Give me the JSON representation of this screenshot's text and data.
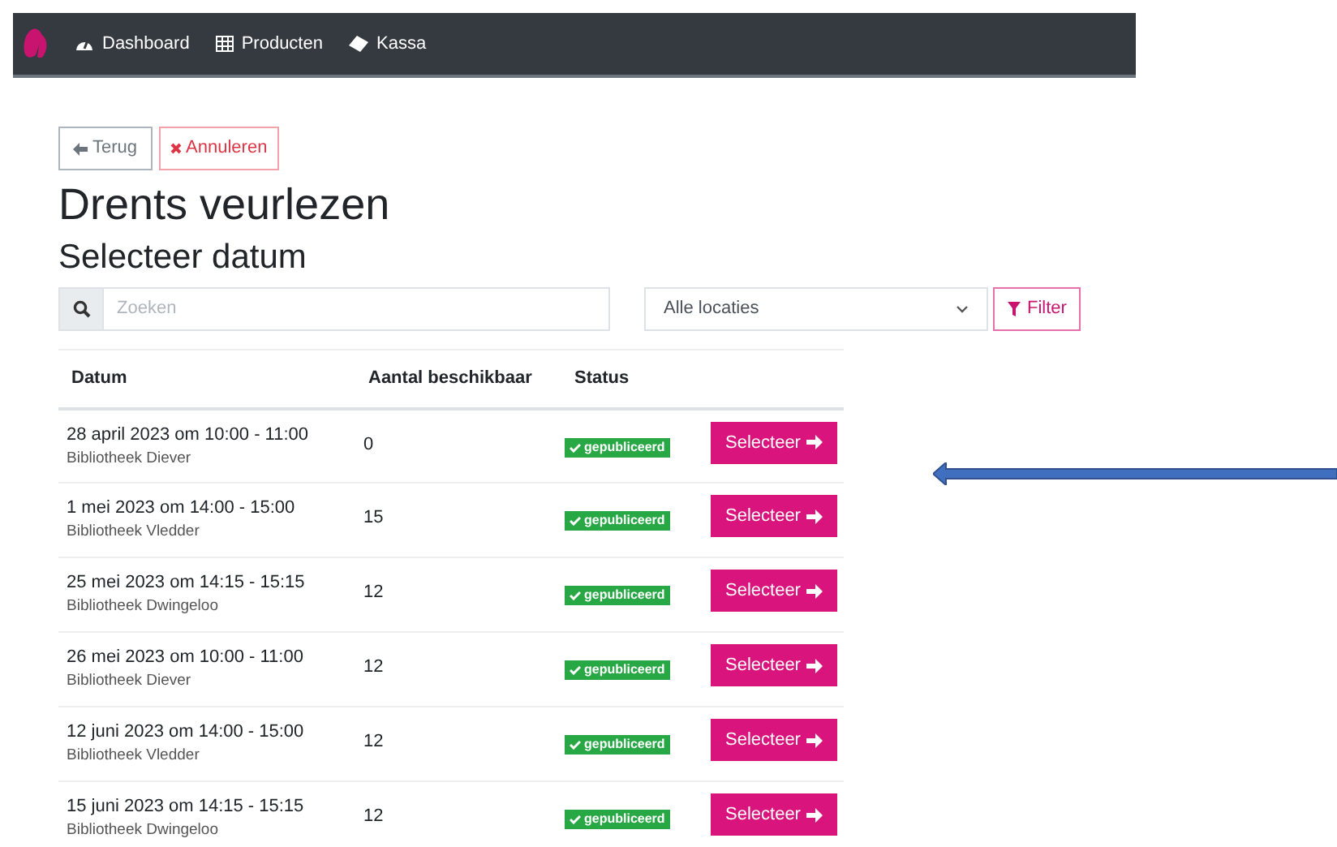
{
  "navbar": {
    "items": [
      {
        "label": "Dashboard"
      },
      {
        "label": "Producten"
      },
      {
        "label": "Kassa"
      }
    ]
  },
  "buttons": [
    {
      "label": "Terug",
      "kind": "back"
    },
    {
      "label": "Annuleren",
      "kind": "cancel"
    }
  ],
  "title": "Drents veurlezen",
  "subtitle": "Selecteer datum",
  "search": {
    "placeholder": "Zoeken"
  },
  "location_select": {
    "value": "Alle locaties"
  },
  "filter_button": "Filter",
  "table": {
    "columns": [
      "Datum",
      "Aantal beschikbaar",
      "Status"
    ],
    "rows": [
      {
        "date": "28 april 2023 om 10:00 - 11:00",
        "location": "Bibliotheek Diever",
        "available": "0",
        "status": "gepubliceerd",
        "action": "Selecteer"
      },
      {
        "date": "1 mei 2023 om 14:00 - 15:00",
        "location": "Bibliotheek Vledder",
        "available": "15",
        "status": "gepubliceerd",
        "action": "Selecteer"
      },
      {
        "date": "25 mei 2023 om 14:15 - 15:15",
        "location": "Bibliotheek Dwingeloo",
        "available": "12",
        "status": "gepubliceerd",
        "action": "Selecteer"
      },
      {
        "date": "26 mei 2023 om 10:00 - 11:00",
        "location": "Bibliotheek Diever",
        "available": "12",
        "status": "gepubliceerd",
        "action": "Selecteer"
      },
      {
        "date": "12 juni 2023 om 14:00 - 15:00",
        "location": "Bibliotheek Vledder",
        "available": "12",
        "status": "gepubliceerd",
        "action": "Selecteer"
      },
      {
        "date": "15 juni 2023 om 14:15 - 15:15",
        "location": "Bibliotheek Dwingeloo",
        "available": "12",
        "status": "gepubliceerd",
        "action": "Selecteer"
      }
    ]
  }
}
